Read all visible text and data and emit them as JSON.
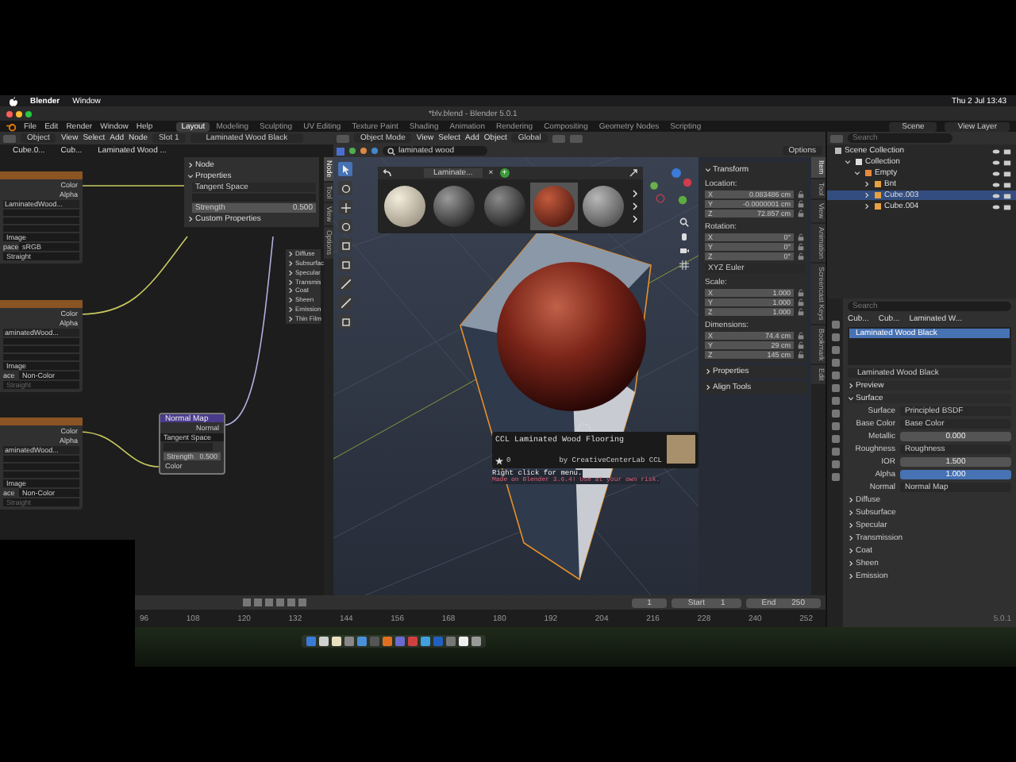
{
  "menubar": {
    "app": "Blender",
    "items": [
      "Window"
    ],
    "clock": "Thu 2 Jul 13:43"
  },
  "window": {
    "title": "*blv.blend - Blender 5.0.1"
  },
  "topbar": {
    "menus": [
      "File",
      "Edit",
      "Render",
      "Window",
      "Help"
    ],
    "workspaces": [
      {
        "label": "Layout",
        "selected": true
      },
      {
        "label": "Modeling",
        "selected": false
      },
      {
        "label": "Sculpting",
        "selected": false
      },
      {
        "label": "UV Editing",
        "selected": false
      },
      {
        "label": "Texture Paint",
        "selected": false
      },
      {
        "label": "Shading",
        "selected": false
      },
      {
        "label": "Animation",
        "selected": false
      },
      {
        "label": "Rendering",
        "selected": false
      },
      {
        "label": "Compositing",
        "selected": false
      },
      {
        "label": "Geometry Nodes",
        "selected": false
      },
      {
        "label": "Scripting",
        "selected": false
      }
    ],
    "scene": "Scene",
    "view_layer": "View Layer"
  },
  "node_editor": {
    "header": {
      "object": "Object",
      "menus": [
        "View",
        "Select",
        "Add",
        "Node"
      ],
      "slot": "Slot 1",
      "material": "Laminated Wood Black"
    },
    "breadcrumbs": [
      "Cube.0...",
      "Cub...",
      "Laminated Wood ..."
    ],
    "image_nodes": [
      {
        "outputs": [
          "Color",
          "Alpha"
        ],
        "image": "LaminatedWood...",
        "rows": [
          {
            "value": "Image",
            "disabled": false
          },
          {
            "label": "pace",
            "value": "sRGB",
            "disabled": false
          },
          {
            "value": "Straight",
            "disabled": false
          }
        ]
      },
      {
        "outputs": [
          "Color",
          "Alpha"
        ],
        "image": "aminatedWood...",
        "rows": [
          {
            "value": "Image",
            "disabled": false
          },
          {
            "label": "ace",
            "value": "Non-Color",
            "disabled": false
          },
          {
            "value": "Straight",
            "disabled": true
          }
        ]
      },
      {
        "outputs": [
          "Color",
          "Alpha"
        ],
        "image": "aminatedWood...",
        "rows": [
          {
            "value": "Image",
            "disabled": false
          },
          {
            "label": "ace",
            "value": "Non-Color",
            "disabled": false
          },
          {
            "value": "Straight",
            "disabled": true
          }
        ]
      }
    ],
    "normal_map": {
      "title": "Normal Map",
      "output": "Normal",
      "space": "Tangent Space",
      "strength_label": "Strength",
      "strength": "0.500",
      "input": "Color"
    },
    "bsdf_panels": [
      "Diffuse",
      "Subsurfac",
      "Specular",
      "Transmis",
      "Coat",
      "Sheen",
      "Emission",
      "Thin Film"
    ],
    "sidebar": {
      "tabs": [
        {
          "label": "Node",
          "selected": true
        },
        {
          "label": "Tool",
          "selected": false
        },
        {
          "label": "View",
          "selected": false
        },
        {
          "label": "Options",
          "selected": false
        }
      ],
      "node_panel": {
        "label": "Node",
        "expanded": false
      },
      "properties_panel": {
        "label": "Properties",
        "expanded": true,
        "space": "Tangent Space",
        "strength_label": "Strength",
        "strength": "0.500"
      },
      "custom_panel": {
        "label": "Custom Properties",
        "expanded": false
      }
    }
  },
  "viewport": {
    "mode": "Object Mode",
    "menus": [
      "View",
      "Select",
      "Add",
      "Object"
    ],
    "orientation": "Global",
    "search": "laminated wood",
    "options": "Options",
    "asset_popup": {
      "tab": "Laminate...",
      "close": "×",
      "add": "+",
      "thumbnails": [
        {
          "selected": false
        },
        {
          "selected": false
        },
        {
          "selected": false
        },
        {
          "selected": true
        },
        {
          "selected": false
        }
      ]
    },
    "tooltip": {
      "title": "CCL Laminated Wood Flooring",
      "stars_text": "0",
      "author": "by CreativeCenterLab CCL",
      "hint": "Right click for menu.",
      "warning": "Made on Blender 3.6.4! Use at your own risk."
    }
  },
  "n_panel": {
    "tabs": [
      {
        "label": "Item",
        "selected": true
      },
      {
        "label": "Tool",
        "selected": false
      },
      {
        "label": "View",
        "selected": false
      },
      {
        "label": "Animation",
        "selected": false
      },
      {
        "label": "Screencast Keys",
        "selected": false
      },
      {
        "label": "Bookmark",
        "selected": false
      },
      {
        "label": "Edit",
        "selected": false
      }
    ],
    "transform": {
      "title": "Transform",
      "groups": [
        {
          "label": "Location:",
          "rows": [
            {
              "axis": "X",
              "value": "0.083486 cm"
            },
            {
              "axis": "Y",
              "value": "-0.0000001 cm"
            },
            {
              "axis": "Z",
              "value": "72.857 cm"
            }
          ]
        },
        {
          "label": "Rotation:",
          "rows": [
            {
              "axis": "X",
              "value": "0°"
            },
            {
              "axis": "Y",
              "value": "0°"
            },
            {
              "axis": "Z",
              "value": "0°"
            }
          ],
          "mode": "XYZ Euler"
        },
        {
          "label": "Scale:",
          "rows": [
            {
              "axis": "X",
              "value": "1.000"
            },
            {
              "axis": "Y",
              "value": "1.000"
            },
            {
              "axis": "Z",
              "value": "1.000"
            }
          ]
        },
        {
          "label": "Dimensions:",
          "rows": [
            {
              "axis": "X",
              "value": "74.4 cm"
            },
            {
              "axis": "Y",
              "value": "29 cm"
            },
            {
              "axis": "Z",
              "value": "145 cm"
            }
          ]
        }
      ]
    },
    "collapsed": [
      "Properties",
      "Align Tools"
    ]
  },
  "outliner": {
    "search_placeholder": "Search",
    "items": [
      {
        "label": "Scene Collection",
        "kind": "scene",
        "selected": false,
        "children": [
          {
            "label": "Collection",
            "kind": "collection",
            "selected": false,
            "expanded": true,
            "children": [
              {
                "label": "Empty",
                "kind": "empty",
                "selected": false,
                "expanded": true,
                "children": [
                  {
                    "label": "Bnt",
                    "kind": "mesh",
                    "selected": false,
                    "expanded": false
                  },
                  {
                    "label": "Cube.003",
                    "kind": "mesh",
                    "selected": true,
                    "expanded": false
                  },
                  {
                    "label": "Cube.004",
                    "kind": "mesh",
                    "selected": false,
                    "expanded": false
                  }
                ]
              }
            ]
          }
        ]
      }
    ]
  },
  "properties": {
    "search_placeholder": "Search",
    "breadcrumbs": [
      "Cub...",
      "Cub...",
      "Laminated W..."
    ],
    "slots": [
      {
        "label": "Laminated Wood Black",
        "selected": true
      }
    ],
    "material": "Laminated Wood Black",
    "sections": [
      {
        "label": "Preview",
        "expanded": false
      },
      {
        "label": "Surface",
        "expanded": true
      }
    ],
    "surface": {
      "label": "Surface",
      "value": "Principled BSDF"
    },
    "inputs": [
      {
        "kind": "link",
        "label": "Base Color",
        "value": "Base Color"
      },
      {
        "kind": "number",
        "label": "Metallic",
        "value": "0.000"
      },
      {
        "kind": "link",
        "label": "Roughness",
        "value": "Roughness"
      },
      {
        "kind": "number",
        "label": "IOR",
        "value": "1.500"
      },
      {
        "kind": "slider",
        "label": "Alpha",
        "value": "1.000",
        "level": 1
      },
      {
        "kind": "link",
        "label": "Normal",
        "value": "Normal Map"
      }
    ],
    "subpanels": [
      {
        "label": "Diffuse",
        "expanded": false
      },
      {
        "label": "Subsurface",
        "expanded": false
      },
      {
        "label": "Specular",
        "expanded": false
      },
      {
        "label": "Transmission",
        "expanded": false
      },
      {
        "label": "Coat",
        "expanded": false
      },
      {
        "label": "Sheen",
        "expanded": false
      },
      {
        "label": "Emission",
        "expanded": false
      }
    ],
    "version": "5.0.1"
  },
  "timeline": {
    "frame": "1",
    "start_label": "Start",
    "start": "1",
    "end_label": "End",
    "end": "250",
    "ticks": [
      "96",
      "108",
      "120",
      "132",
      "144",
      "156",
      "168",
      "180",
      "192",
      "204",
      "216",
      "228",
      "240",
      "252"
    ]
  }
}
